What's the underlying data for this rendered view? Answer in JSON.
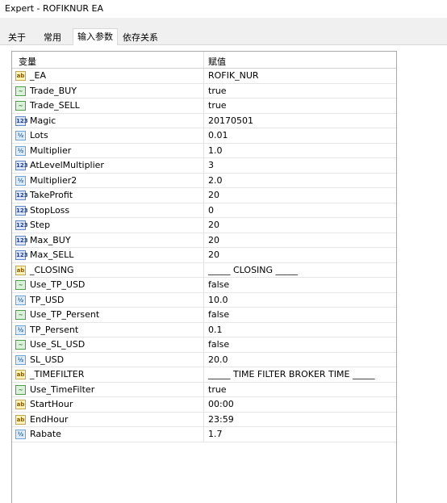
{
  "window": {
    "title": "Expert - ROFIKNUR EA"
  },
  "tabs": [
    {
      "label": "关于",
      "active": false
    },
    {
      "label": "常用",
      "active": false
    },
    {
      "label": "输入参数",
      "active": true
    },
    {
      "label": "依存关系",
      "active": false
    }
  ],
  "grid": {
    "col_variable": "变量",
    "col_value": "赋值",
    "rows": [
      {
        "type": "string",
        "icon": "string-type-icon",
        "name": "_EA",
        "value": "ROFIK_NUR"
      },
      {
        "type": "bool",
        "icon": "bool-type-icon",
        "name": "Trade_BUY",
        "value": "true"
      },
      {
        "type": "bool",
        "icon": "bool-type-icon",
        "name": "Trade_SELL",
        "value": "true"
      },
      {
        "type": "int",
        "icon": "int-type-icon",
        "name": "Magic",
        "value": "20170501"
      },
      {
        "type": "double",
        "icon": "double-type-icon",
        "name": "Lots",
        "value": "0.01"
      },
      {
        "type": "double",
        "icon": "double-type-icon",
        "name": "Multiplier",
        "value": "1.0"
      },
      {
        "type": "int",
        "icon": "int-type-icon",
        "name": "AtLevelMultiplier",
        "value": "3"
      },
      {
        "type": "double",
        "icon": "double-type-icon",
        "name": "Multiplier2",
        "value": "2.0"
      },
      {
        "type": "int",
        "icon": "int-type-icon",
        "name": "TakeProfit",
        "value": "20"
      },
      {
        "type": "int",
        "icon": "int-type-icon",
        "name": "StopLoss",
        "value": "0"
      },
      {
        "type": "int",
        "icon": "int-type-icon",
        "name": "Step",
        "value": "20"
      },
      {
        "type": "int",
        "icon": "int-type-icon",
        "name": "Max_BUY",
        "value": "20"
      },
      {
        "type": "int",
        "icon": "int-type-icon",
        "name": "Max_SELL",
        "value": "20"
      },
      {
        "type": "string",
        "icon": "string-type-icon",
        "name": "_CLOSING",
        "value": "_____ CLOSING _____"
      },
      {
        "type": "bool",
        "icon": "bool-type-icon",
        "name": "Use_TP_USD",
        "value": "false"
      },
      {
        "type": "double",
        "icon": "double-type-icon",
        "name": "TP_USD",
        "value": "10.0"
      },
      {
        "type": "bool",
        "icon": "bool-type-icon",
        "name": "Use_TP_Persent",
        "value": "false"
      },
      {
        "type": "double",
        "icon": "double-type-icon",
        "name": "TP_Persent",
        "value": "0.1"
      },
      {
        "type": "bool",
        "icon": "bool-type-icon",
        "name": "Use_SL_USD",
        "value": "false"
      },
      {
        "type": "double",
        "icon": "double-type-icon",
        "name": "SL_USD",
        "value": "20.0"
      },
      {
        "type": "string",
        "icon": "string-type-icon",
        "name": "_TIMEFILTER",
        "value": "_____ TIME FILTER BROKER TIME _____"
      },
      {
        "type": "bool",
        "icon": "bool-type-icon",
        "name": "Use_TimeFilter",
        "value": "true"
      },
      {
        "type": "string",
        "icon": "string-type-icon",
        "name": "StartHour",
        "value": "00:00"
      },
      {
        "type": "string",
        "icon": "string-type-icon",
        "name": "EndHour",
        "value": "23:59"
      },
      {
        "type": "double",
        "icon": "double-type-icon",
        "name": "Rabate",
        "value": "1.7"
      }
    ]
  }
}
